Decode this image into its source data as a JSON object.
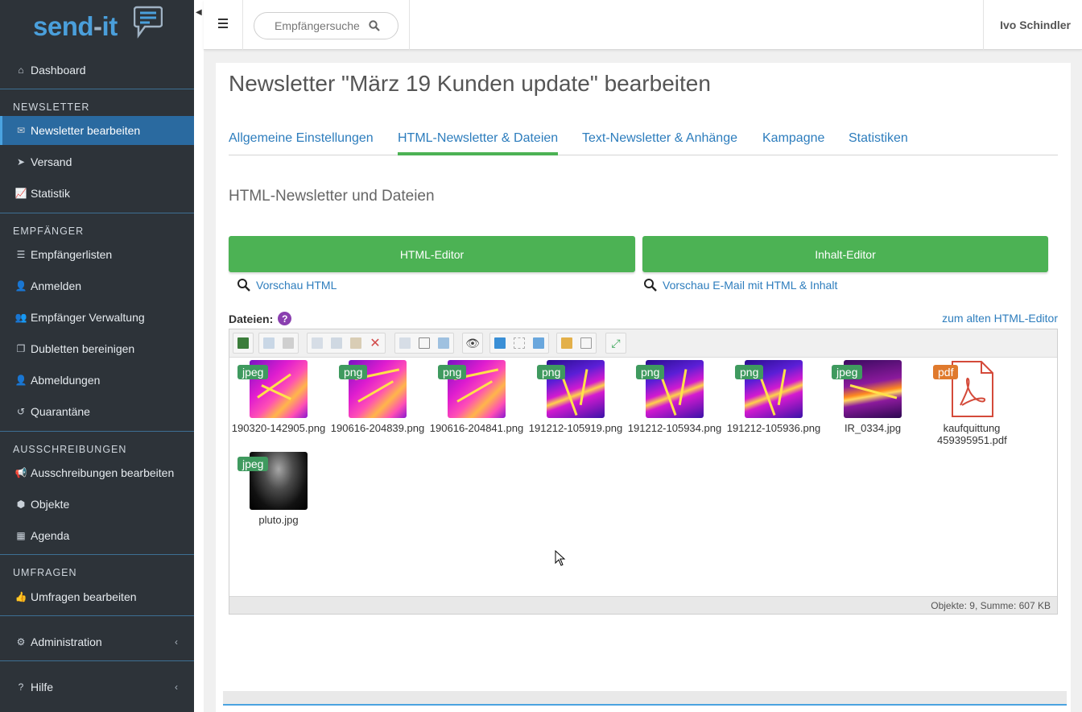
{
  "sidebar": {
    "logo": {
      "part1": "send",
      "part2": "-",
      "part3": "it"
    },
    "items": {
      "dashboard": "Dashboard",
      "newsletter_edit": "Newsletter bearbeiten",
      "versand": "Versand",
      "statistik": "Statistik",
      "empfaengerlisten": "Empfängerlisten",
      "anmelden": "Anmelden",
      "empfaenger_verwaltung": "Empfänger Verwaltung",
      "dubletten": "Dubletten bereinigen",
      "abmeldungen": "Abmeldungen",
      "quarantaene": "Quarantäne",
      "ausschreibungen_edit": "Ausschreibungen bearbeiten",
      "objekte": "Objekte",
      "agenda": "Agenda",
      "umfragen_edit": "Umfragen bearbeiten",
      "administration": "Administration",
      "hilfe": "Hilfe"
    },
    "sections": {
      "newsletter": "NEWSLETTER",
      "empfaenger": "EMPFÄNGER",
      "ausschreibungen": "AUSSCHREIBUNGEN",
      "umfragen": "UMFRAGEN"
    },
    "active_color": "#2a6aa0"
  },
  "header": {
    "search_placeholder": "Empfängersuche",
    "user_name": "Ivo Schindler"
  },
  "main": {
    "title": "Newsletter \"März 19 Kunden update\" bearbeiten",
    "tabs": [
      {
        "label": "Allgemeine Einstellungen"
      },
      {
        "label": "HTML-Newsletter & Dateien",
        "active": true
      },
      {
        "label": "Text-Newsletter & Anhänge"
      },
      {
        "label": "Kampagne"
      },
      {
        "label": "Statistiken"
      }
    ],
    "section_title": "HTML-Newsletter und Dateien",
    "buttons": {
      "html_editor": "HTML-Editor",
      "inhalt_editor": "Inhalt-Editor"
    },
    "links": {
      "preview_html": "Vorschau HTML",
      "preview_email": "Vorschau E-Mail mit HTML & Inhalt",
      "old_editor": "zum alten HTML-Editor"
    },
    "files_label": "Dateien:",
    "help": "?",
    "files": [
      {
        "name": "190320-142905.png",
        "badge": "jpeg"
      },
      {
        "name": "190616-204839.png",
        "badge": "png"
      },
      {
        "name": "190616-204841.png",
        "badge": "png"
      },
      {
        "name": "191212-105919.png",
        "badge": "png"
      },
      {
        "name": "191212-105934.png",
        "badge": "png"
      },
      {
        "name": "191212-105936.png",
        "badge": "png"
      },
      {
        "name": "IR_0334.jpg",
        "badge": "jpeg"
      },
      {
        "name": "kaufquittung 459395951.pdf",
        "badge": "pdf"
      },
      {
        "name": "pluto.jpg",
        "badge": "jpeg"
      }
    ],
    "status": "Objekte: 9, Summe: 607 KB",
    "colors": {
      "accent_green": "#4cb254",
      "link_blue": "#2d7dbd",
      "badge_green": "#3f9a5f",
      "badge_orange": "#e07a2d"
    }
  }
}
